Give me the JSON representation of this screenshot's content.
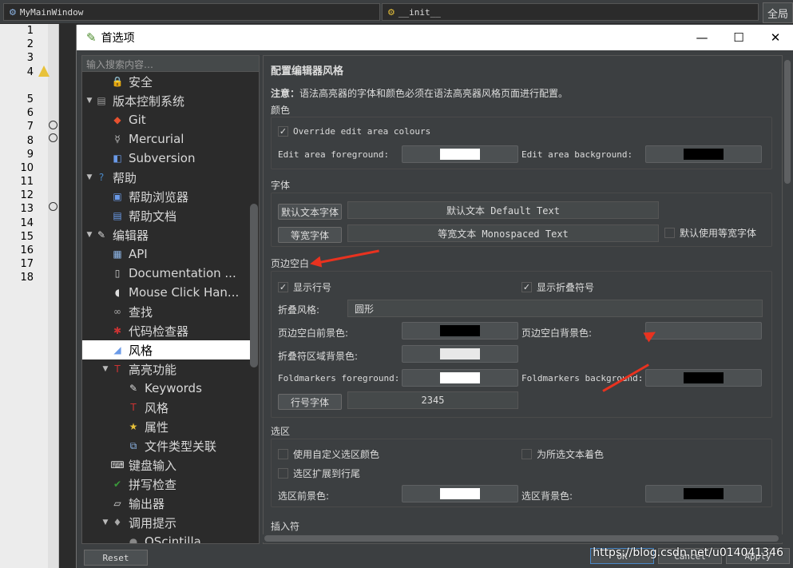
{
  "background": {
    "tab1": "MyMainWindow",
    "tab2": "__init__",
    "full_label": "全局",
    "line_numbers": [
      "1",
      "2",
      "3",
      "4",
      "",
      "5",
      "6",
      "7",
      "8",
      "9",
      "10",
      "11",
      "12",
      "13",
      "14",
      "15",
      "16",
      "17",
      "18"
    ]
  },
  "dialog": {
    "title": "首选项",
    "search_placeholder": "输入搜索内容…",
    "tree": [
      {
        "label": "安全",
        "level": 1,
        "icon": "lock-icon",
        "arrow": ""
      },
      {
        "label": "版本控制系统",
        "level": 0,
        "icon": "database-icon",
        "arrow": "▼"
      },
      {
        "label": "Git",
        "level": 1,
        "icon": "git-icon",
        "arrow": ""
      },
      {
        "label": "Mercurial",
        "level": 1,
        "icon": "mercurial-icon",
        "arrow": ""
      },
      {
        "label": "Subversion",
        "level": 1,
        "icon": "subversion-icon",
        "arrow": ""
      },
      {
        "label": "帮助",
        "level": 0,
        "icon": "help-icon",
        "arrow": "▼"
      },
      {
        "label": "帮助浏览器",
        "level": 1,
        "icon": "help-browser-icon",
        "arrow": ""
      },
      {
        "label": "帮助文档",
        "level": 1,
        "icon": "help-docs-icon",
        "arrow": ""
      },
      {
        "label": "编辑器",
        "level": 0,
        "icon": "editor-icon",
        "arrow": "▼"
      },
      {
        "label": "API",
        "level": 1,
        "icon": "api-icon",
        "arrow": ""
      },
      {
        "label": "Documentation ...",
        "level": 1,
        "icon": "documentation-icon",
        "arrow": ""
      },
      {
        "label": "Mouse Click Han...",
        "level": 1,
        "icon": "mouse-icon",
        "arrow": ""
      },
      {
        "label": "查找",
        "level": 1,
        "icon": "binoculars-icon",
        "arrow": ""
      },
      {
        "label": "代码检查器",
        "level": 1,
        "icon": "bug-icon",
        "arrow": ""
      },
      {
        "label": "风格",
        "level": 1,
        "icon": "style-icon",
        "arrow": "",
        "selected": true
      },
      {
        "label": "高亮功能",
        "level": 1,
        "icon": "highlight-icon",
        "arrow": "▼"
      },
      {
        "label": "Keywords",
        "level": 2,
        "icon": "keywords-icon",
        "arrow": ""
      },
      {
        "label": "风格",
        "level": 2,
        "icon": "highlight-style-icon",
        "arrow": ""
      },
      {
        "label": "属性",
        "level": 2,
        "icon": "star-icon",
        "arrow": ""
      },
      {
        "label": "文件类型关联",
        "level": 2,
        "icon": "filetype-icon",
        "arrow": ""
      },
      {
        "label": "键盘输入",
        "level": 1,
        "icon": "keyboard-icon",
        "arrow": ""
      },
      {
        "label": "拼写检查",
        "level": 1,
        "icon": "spellcheck-icon",
        "arrow": ""
      },
      {
        "label": "输出器",
        "level": 1,
        "icon": "exporter-icon",
        "arrow": ""
      },
      {
        "label": "调用提示",
        "level": 1,
        "icon": "calltips-icon",
        "arrow": "▼"
      },
      {
        "label": "QScintilla",
        "level": 2,
        "icon": "qscintilla-icon",
        "arrow": ""
      }
    ],
    "page_title": "配置编辑器风格",
    "note_bold": "注意：",
    "note_text": "语法高亮器的字体和颜色必须在语法高亮器风格页面进行配置。",
    "colors": {
      "heading": "颜色",
      "override_label": "Override edit area colours",
      "override_checked": true,
      "fg_label": "Edit area foreground:",
      "fg_color": "#ffffff",
      "bg_label": "Edit area background:",
      "bg_color": "#000000"
    },
    "fonts": {
      "heading": "字体",
      "default_btn": "默认文本字体",
      "default_sample": "默认文本 Default Text",
      "mono_btn": "等宽字体",
      "mono_sample": "等宽文本 Monospaced Text",
      "use_mono_label": "默认使用等宽字体",
      "use_mono_checked": false
    },
    "margins": {
      "heading": "页边空白",
      "show_line_numbers": "显示行号",
      "show_line_numbers_checked": true,
      "show_fold_markers": "显示折叠符号",
      "show_fold_markers_checked": true,
      "fold_style_label": "折叠风格:",
      "fold_style_value": "圆形",
      "margin_fg_label": "页边空白前景色:",
      "margin_fg_color": "#000000",
      "margin_bg_label": "页边空白背景色:",
      "margin_bg_color": "#4c5052",
      "fold_bg_label": "折叠符区域背景色:",
      "fold_bg_color": "#e8e8e8",
      "foldmarkers_fg_label": "Foldmarkers foreground:",
      "foldmarkers_fg_color": "#ffffff",
      "foldmarkers_bg_label": "Foldmarkers background:",
      "foldmarkers_bg_color": "#000000",
      "line_number_font_btn": "行号字体",
      "line_number_font_sample": "2345"
    },
    "selection": {
      "heading": "选区",
      "custom_sel_colors": "使用自定义选区颜色",
      "custom_sel_colors_checked": false,
      "colour_all_selected": "为所选文本着色",
      "colour_all_selected_checked": false,
      "extend_to_eol": "选区扩展到行尾",
      "extend_to_eol_checked": false,
      "sel_fg_label": "选区前景色:",
      "sel_fg_color": "#ffffff",
      "sel_bg_label": "选区背景色:",
      "sel_bg_color": "#000000"
    },
    "caret_heading": "插入符",
    "buttons": {
      "reset": "Reset",
      "ok": "OK",
      "cancel": "Cancel",
      "apply": "Apply"
    },
    "annotation_color": "#e8321f"
  },
  "watermark": "https://blog.csdn.net/u014041346"
}
